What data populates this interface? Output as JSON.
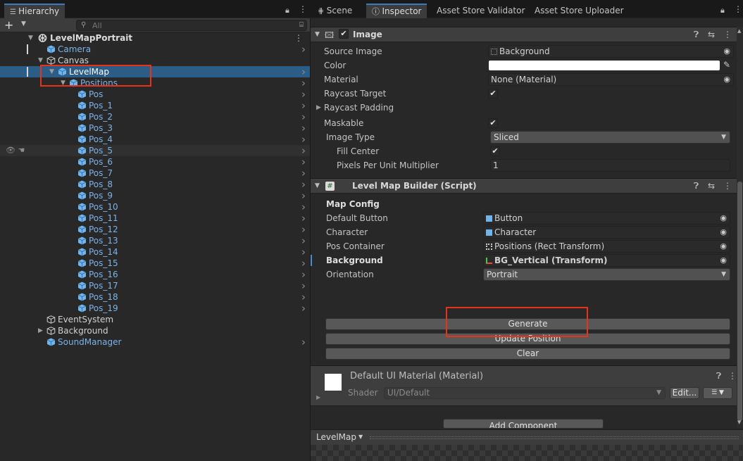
{
  "hierarchy": {
    "tab_label": "Hierarchy",
    "search_placeholder": "All",
    "add_label": "+",
    "scene": "LevelMapPortrait",
    "items": [
      {
        "label": "Camera",
        "color": "blue"
      },
      {
        "label": "Canvas",
        "color": "white"
      },
      {
        "label": "LevelMap",
        "color": "white"
      },
      {
        "label": "Positions",
        "color": "blue"
      },
      {
        "label": "Pos",
        "color": "blue"
      },
      {
        "label": "Pos_1",
        "color": "blue"
      },
      {
        "label": "Pos_2",
        "color": "blue"
      },
      {
        "label": "Pos_3",
        "color": "blue"
      },
      {
        "label": "Pos_4",
        "color": "blue"
      },
      {
        "label": "Pos_5",
        "color": "blue"
      },
      {
        "label": "Pos_6",
        "color": "blue"
      },
      {
        "label": "Pos_7",
        "color": "blue"
      },
      {
        "label": "Pos_8",
        "color": "blue"
      },
      {
        "label": "Pos_9",
        "color": "blue"
      },
      {
        "label": "Pos_10",
        "color": "blue"
      },
      {
        "label": "Pos_11",
        "color": "blue"
      },
      {
        "label": "Pos_12",
        "color": "blue"
      },
      {
        "label": "Pos_13",
        "color": "blue"
      },
      {
        "label": "Pos_14",
        "color": "blue"
      },
      {
        "label": "Pos_15",
        "color": "blue"
      },
      {
        "label": "Pos_16",
        "color": "blue"
      },
      {
        "label": "Pos_17",
        "color": "blue"
      },
      {
        "label": "Pos_18",
        "color": "blue"
      },
      {
        "label": "Pos_19",
        "color": "blue"
      },
      {
        "label": "EventSystem",
        "color": "white"
      },
      {
        "label": "Background",
        "color": "white"
      },
      {
        "label": "SoundManager",
        "color": "blue"
      }
    ]
  },
  "tabs": {
    "scene": "Scene",
    "inspector": "Inspector",
    "asset_validator": "Asset Store Validator",
    "asset_uploader": "Asset Store Uploader"
  },
  "image_component": {
    "title": "Image",
    "source_image_label": "Source Image",
    "source_image_value": "Background",
    "color_label": "Color",
    "material_label": "Material",
    "material_value": "None (Material)",
    "raycast_target_label": "Raycast Target",
    "raycast_padding_label": "Raycast Padding",
    "maskable_label": "Maskable",
    "image_type_label": "Image Type",
    "image_type_value": "Sliced",
    "fill_center_label": "Fill Center",
    "ppu_label": "Pixels Per Unit Multiplier",
    "ppu_value": "1"
  },
  "builder_component": {
    "title": "Level Map Builder (Script)",
    "map_config_label": "Map Config",
    "default_button_label": "Default Button",
    "default_button_value": "Button",
    "character_label": "Character",
    "character_value": "Character",
    "pos_container_label": "Pos Container",
    "pos_container_value": "Positions (Rect Transform)",
    "background_label": "Background",
    "background_value": "BG_Vertical (Transform)",
    "orientation_label": "Orientation",
    "orientation_value": "Portrait",
    "generate_label": "Generate",
    "update_position_label": "Update Position",
    "clear_label": "Clear"
  },
  "material_section": {
    "title": "Default UI Material (Material)",
    "shader_label": "Shader",
    "shader_value": "UI/Default",
    "edit_label": "Edit..."
  },
  "add_component_label": "Add Component",
  "preview_label": "LevelMap",
  "colors": {
    "selection": "#2c5d87",
    "highlight_box": "#e8321c",
    "prefab_blue": "#7cb3e8"
  }
}
